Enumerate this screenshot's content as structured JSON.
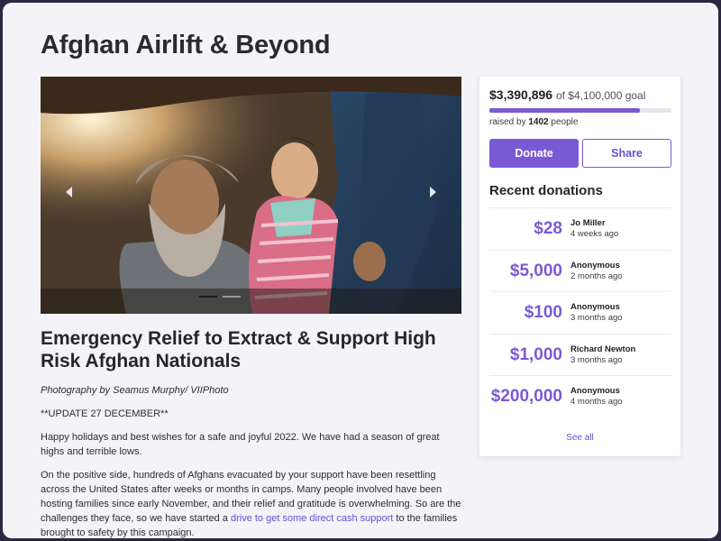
{
  "page": {
    "title": "Afghan Airlift & Beyond",
    "subtitle": "Emergency Relief to Extract & Support High Risk Afghan Nationals"
  },
  "hero": {
    "slides": 2,
    "active_slide": 1
  },
  "fundraiser": {
    "raised": "$3,390,896",
    "goal_text": "of $4,100,000 goal",
    "progress_fraction": 0.827,
    "raised_by_prefix": "raised by",
    "supporters": "1402",
    "raised_by_suffix": "people",
    "donate_label": "Donate",
    "share_label": "Share",
    "recent_title": "Recent donations",
    "see_all_label": "See all",
    "donations": [
      {
        "amount": "$28",
        "name": "Jo Miller",
        "time": "4 weeks ago"
      },
      {
        "amount": "$5,000",
        "name": "Anonymous",
        "time": "2 months ago"
      },
      {
        "amount": "$100",
        "name": "Anonymous",
        "time": "3 months ago"
      },
      {
        "amount": "$1,000",
        "name": "Richard Newton",
        "time": "3 months ago"
      },
      {
        "amount": "$200,000",
        "name": "Anonymous",
        "time": "4 months ago"
      }
    ]
  },
  "story": {
    "credit": "Photography by Seamus Murphy/ VIIPhoto",
    "update": "**UPDATE 27 DECEMBER**",
    "para1": "Happy holidays and best wishes for a safe and joyful 2022. We have had a season of great highs and terrible lows.",
    "para2_start": "On the positive side, hundreds of Afghans evacuated by your support have been resettling across the United States after weeks or months in camps. Many people involved have been hosting families since early November, and their relief and gratitude is overwhelming. So are the challenges they face, so we have started a ",
    "para2_link": "drive to get some direct cash support",
    "para2_end": " to the families brought to safety by this campaign."
  },
  "colors": {
    "accent": "#7a59d4",
    "link": "#6b4ed0",
    "background": "#f4f3f8"
  }
}
